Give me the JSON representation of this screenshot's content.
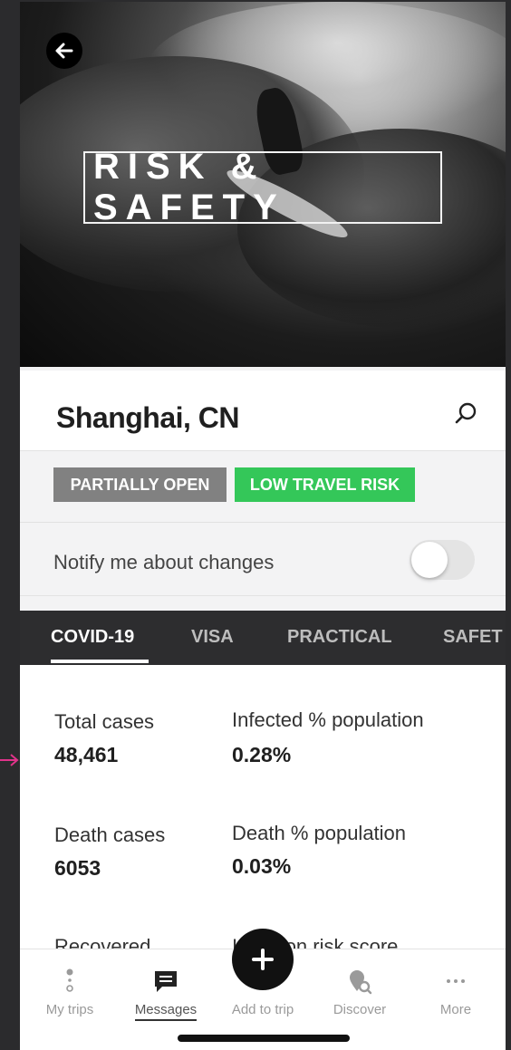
{
  "hero": {
    "title": "RISK & SAFETY"
  },
  "location": {
    "name": "Shanghai, CN"
  },
  "badges": [
    {
      "label": "PARTIALLY OPEN",
      "color": "#818181"
    },
    {
      "label": "LOW TRAVEL RISK",
      "color": "#34c759"
    }
  ],
  "notify": {
    "label": "Notify me about changes",
    "enabled": false
  },
  "tabs": [
    {
      "label": "COVID-19",
      "active": true
    },
    {
      "label": "VISA",
      "active": false
    },
    {
      "label": "PRACTICAL",
      "active": false
    },
    {
      "label": "SAFET",
      "active": false
    }
  ],
  "stats": {
    "total_cases": {
      "label": "Total cases",
      "value": "48,461"
    },
    "infected_pct": {
      "label": "Infected % population",
      "value": "0.28%"
    },
    "death_cases": {
      "label": "Death cases",
      "value": "6053"
    },
    "death_pct": {
      "label": "Death % population",
      "value": "0.03%"
    },
    "recovered_partial": {
      "label": "Recovered"
    },
    "risk_score_partial": {
      "label": "Infection risk score"
    }
  },
  "nav": {
    "items": [
      {
        "label": "My trips",
        "icon": "pin-trail-icon"
      },
      {
        "label": "Messages",
        "icon": "message-icon",
        "active": true
      },
      {
        "label": "Add to trip",
        "icon": "plus-icon"
      },
      {
        "label": "Discover",
        "icon": "location-search-icon"
      },
      {
        "label": "More",
        "icon": "ellipsis-icon"
      }
    ]
  },
  "colors": {
    "accent_green": "#34c759",
    "dark_tab": "#2d2d2f",
    "annotation_pink": "#e0338a"
  }
}
